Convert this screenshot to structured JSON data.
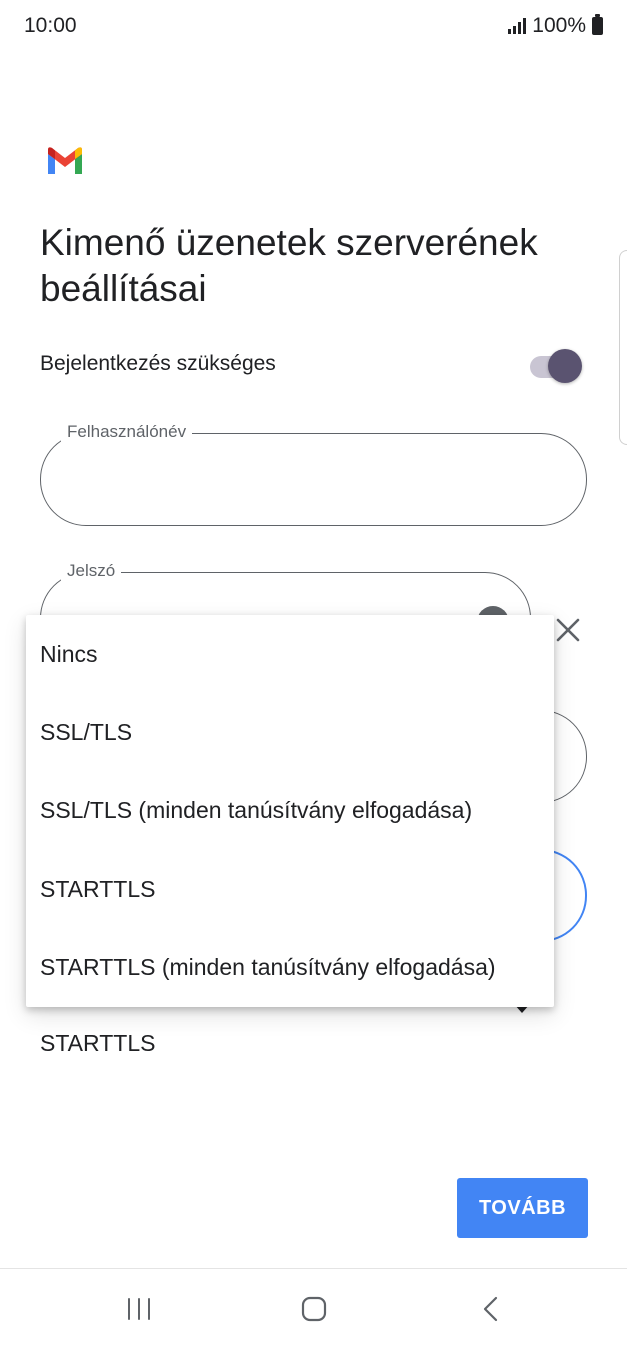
{
  "status_bar": {
    "time": "10:00",
    "battery": "100%"
  },
  "page": {
    "title": "Kimenő üzenetek szerverének beállításai",
    "auth_label": "Bejelentkezés szükséges",
    "auth_enabled": true
  },
  "fields": {
    "username_label": "Felhasználónév",
    "username_value": "",
    "password_label": "Jelszó",
    "password_value": ""
  },
  "security": {
    "selected": "STARTTLS",
    "options": [
      "Nincs",
      "SSL/TLS",
      "SSL/TLS (minden tanúsítvány elfogadása)",
      "STARTTLS",
      "STARTTLS (minden tanúsítvány elfogadása)"
    ]
  },
  "buttons": {
    "next": "TOVÁBB"
  },
  "icons": {
    "logo": "gmail-logo",
    "eye": "eye-icon",
    "clear": "close-icon",
    "dropdown": "triangle-down-icon",
    "nav_recents": "recents-icon",
    "nav_home": "home-icon",
    "nav_back": "back-icon"
  },
  "colors": {
    "accent": "#4285f4",
    "toggle_thumb": "#5a5370",
    "text": "#202124"
  }
}
